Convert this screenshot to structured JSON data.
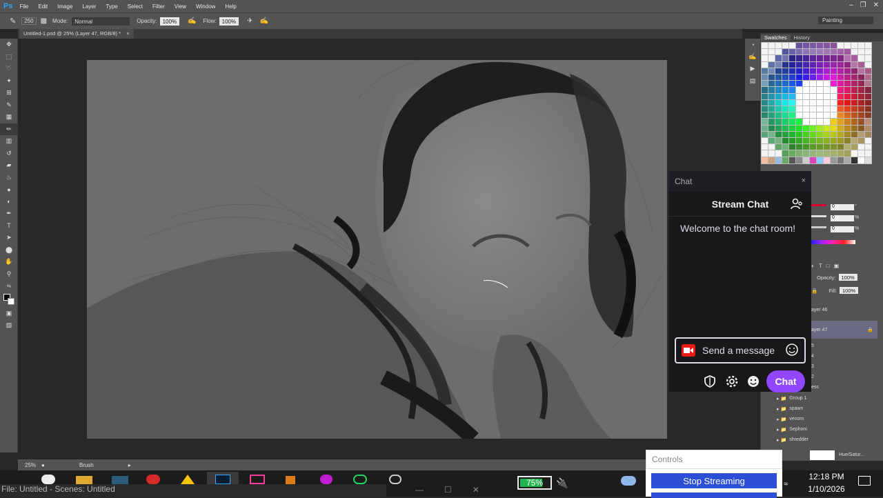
{
  "app": {
    "logo": "Ps",
    "menu": [
      "File",
      "Edit",
      "Image",
      "Layer",
      "Type",
      "Select",
      "Filter",
      "View",
      "Window",
      "Help"
    ]
  },
  "options": {
    "brush_size": "250",
    "mode_label": "Mode:",
    "mode_value": "Normal",
    "opacity_label": "Opacity:",
    "opacity_value": "100%",
    "flow_label": "Flow:",
    "flow_value": "100%",
    "workspace": "Painting"
  },
  "document": {
    "tab_title": "Untitled-1.psd @ 25% (Layer 47, RGB/8) *"
  },
  "status": {
    "zoom": "25%",
    "tool": "Brush"
  },
  "panels": {
    "tabs": [
      "Swatches",
      "History"
    ],
    "color_values": [
      "0",
      "0",
      "0"
    ],
    "pct": [
      "°",
      "%",
      "%"
    ],
    "opacity_label": "Opacity:",
    "opacity_value": "100%",
    "fill_label": "Fill:",
    "fill_value": "100%",
    "layers": [
      "ayer 46",
      "ayer 47",
      "5",
      "4",
      "3",
      "2",
      "ess",
      "Group 1",
      "spawn",
      "venom",
      "Sephoni",
      "shredder",
      "Hue/Satur..."
    ]
  },
  "chat": {
    "window_title": "Chat",
    "close": "×",
    "title": "Stream Chat",
    "welcome": "Welcome to the chat room!",
    "input_placeholder": "Send a message",
    "chat_button": "Chat"
  },
  "controls": {
    "title": "Controls",
    "stop_streaming": "Stop Streaming"
  },
  "obs": {
    "title": "File: Untitled - Scenes: Untitled"
  },
  "taskbar": {
    "battery": "75%",
    "battery_level": 0.75,
    "time": "12:18 PM",
    "date": "1/10/2026"
  },
  "colors": {
    "accent": "#9147ff",
    "stream_blue": "#2c4fd6",
    "battery_green": "#22b14c",
    "ps_blue": "#31a8ff"
  }
}
